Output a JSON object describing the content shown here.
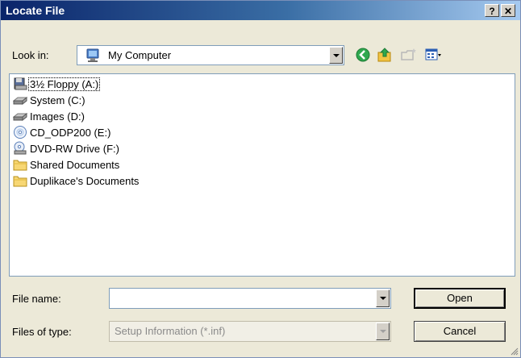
{
  "window": {
    "title": "Locate File",
    "help_glyph": "?",
    "close_glyph": "✕"
  },
  "lookin": {
    "label": "Look in:",
    "value": "My Computer"
  },
  "toolbar": {
    "icons": [
      "back-icon",
      "up-folder-icon",
      "new-folder-icon",
      "view-menu-icon"
    ]
  },
  "items": [
    {
      "label": "3½ Floppy (A:)",
      "icon": "floppy-icon",
      "selected": true
    },
    {
      "label": "System (C:)",
      "icon": "hard-drive-icon",
      "selected": false
    },
    {
      "label": "Images (D:)",
      "icon": "hard-drive-icon",
      "selected": false
    },
    {
      "label": "CD_ODP200 (E:)",
      "icon": "cd-drive-icon",
      "selected": false
    },
    {
      "label": "DVD-RW Drive (F:)",
      "icon": "dvd-drive-icon",
      "selected": false
    },
    {
      "label": "Shared Documents",
      "icon": "folder-icon",
      "selected": false
    },
    {
      "label": "Duplikace's Documents",
      "icon": "folder-icon",
      "selected": false
    }
  ],
  "filename": {
    "label": "File name:",
    "value": ""
  },
  "filetype": {
    "label": "Files of type:",
    "value": "Setup Information (*.inf)"
  },
  "buttons": {
    "open": "Open",
    "cancel": "Cancel"
  }
}
